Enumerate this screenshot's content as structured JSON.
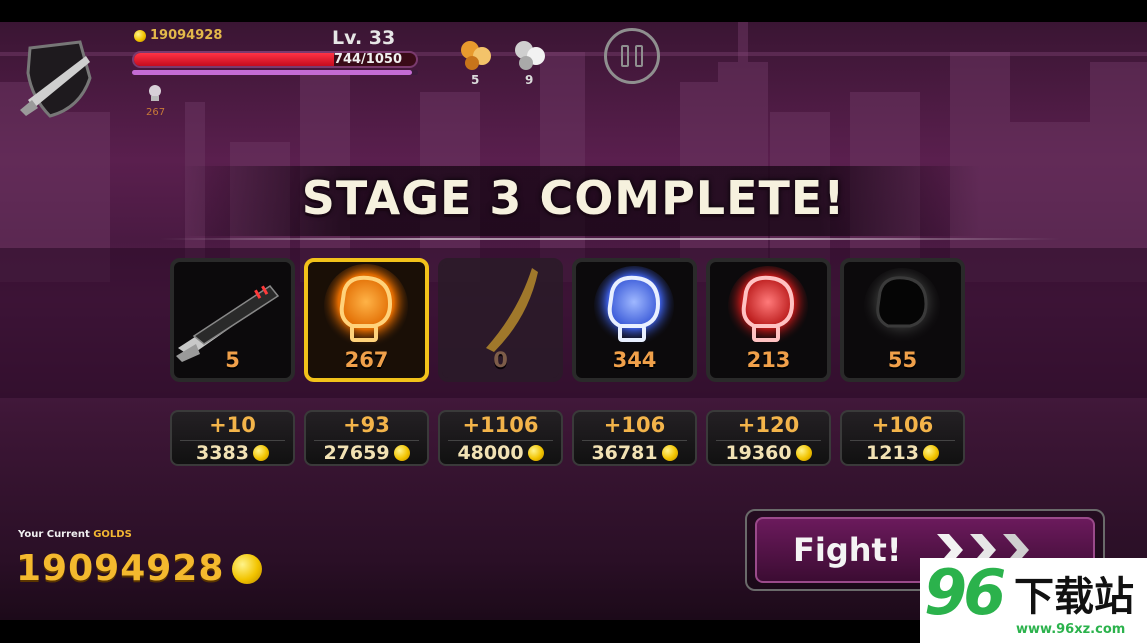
{
  "hud": {
    "gold": "19094928",
    "level": "Lv. 33",
    "hp_text": "744/1050",
    "hp_current": 744,
    "hp_max": 1050,
    "xp_fraction": 0.98,
    "glove_count": "267",
    "orb_orange_count": "5",
    "orb_white_count": "9",
    "pause_icon": "pause-icon"
  },
  "title": "STAGE 3 COMPLETE!",
  "items": [
    {
      "icon": "shotgun-icon",
      "count": "5",
      "plus": "+10",
      "cost": "3383",
      "state": "normal"
    },
    {
      "icon": "orange-glove-icon",
      "count": "267",
      "plus": "+93",
      "cost": "27659",
      "state": "selected"
    },
    {
      "icon": "blade-icon",
      "count": "0",
      "plus": "+1106",
      "cost": "48000",
      "state": "dim"
    },
    {
      "icon": "blue-glove-icon",
      "count": "344",
      "plus": "+106",
      "cost": "36781",
      "state": "normal"
    },
    {
      "icon": "red-glove-icon",
      "count": "213",
      "plus": "+120",
      "cost": "19360",
      "state": "normal"
    },
    {
      "icon": "black-glove-icon",
      "count": "55",
      "plus": "+106",
      "cost": "1213",
      "state": "normal"
    }
  ],
  "footer": {
    "gold_label_prefix": "Your Current ",
    "gold_label_highlight": "GOLDS",
    "gold_value": "19094928",
    "fight_label": "Fight!"
  },
  "watermark": {
    "number": "96",
    "text": "下载站",
    "url": "www.96xz.com"
  },
  "colors": {
    "accent": "#f2c21a",
    "hp": "#e01a2a",
    "gold": "#f4b92e",
    "panel": "#5a1f4e"
  }
}
